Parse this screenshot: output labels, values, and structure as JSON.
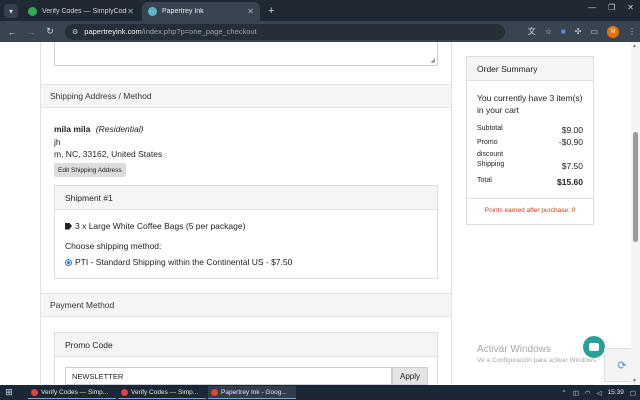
{
  "browser": {
    "tabs": [
      {
        "label": "Verify Codes — SimplyCodes",
        "favicon_color": "#34a853",
        "active": false
      },
      {
        "label": "Papertrey Ink",
        "favicon_color": "#5bb8c9",
        "active": true
      }
    ],
    "new_tab_glyph": "+",
    "window_controls": [
      "—",
      "❐",
      "✕"
    ],
    "url_host": "papertreyink.com",
    "url_path": "/index.php?p=one_page_checkout",
    "profile_initial": "M"
  },
  "checkout": {
    "shipping_section_title": "Shipping Address / Method",
    "address": {
      "name": "mila mila",
      "type": "(Residential)",
      "line1": "jh",
      "line2": "m, NC, 33162, United States"
    },
    "edit_button": "Edit Shipping Address",
    "shipment": {
      "title": "Shipment #1",
      "item": "3 x Large White Coffee Bags (5 per package)",
      "choose_label": "Choose shipping method:",
      "method": "PTI - Standard Shipping within the Continental US - $7.50"
    },
    "payment_section_title": "Payment Method",
    "promo": {
      "title": "Promo Code",
      "value": "NEWSLETTER",
      "apply_label": "Apply"
    }
  },
  "summary": {
    "title": "Order Summary",
    "cart_note": "You currently have 3 item(s) in your cart",
    "rows": [
      {
        "label": "Subtotal",
        "value": "$9.00"
      },
      {
        "label": "Promo discount",
        "value": "-$0.90"
      },
      {
        "label": "Shipping",
        "value": "$7.50"
      },
      {
        "label": "Total",
        "value": "$15.60"
      }
    ],
    "points": "Points earned after purchase: 0"
  },
  "watermark": {
    "line1": "Activar Windows",
    "line2": "Ve a Configuración para activar Windows."
  },
  "taskbar": {
    "items": [
      {
        "label": "Verify Codes — Simp..."
      },
      {
        "label": "Verify Codes — Simp..."
      },
      {
        "label": "Papertrey Ink - Goog..."
      }
    ],
    "time": "15:39"
  }
}
